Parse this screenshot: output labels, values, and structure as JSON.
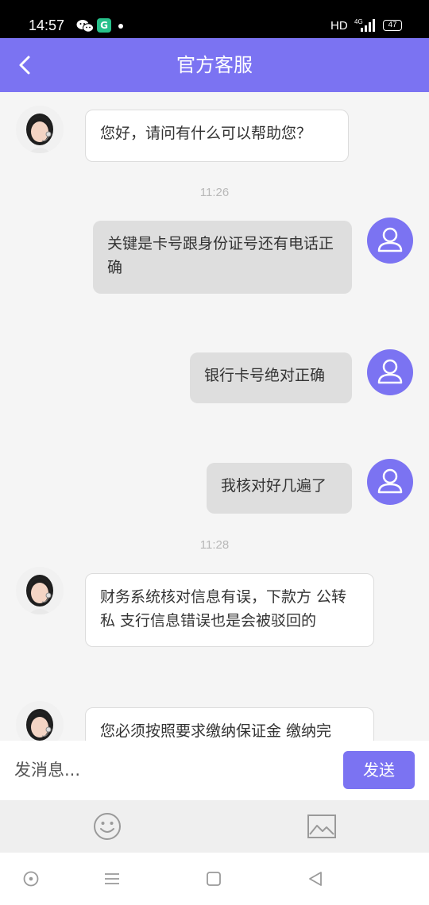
{
  "status_bar": {
    "time": "14:57",
    "hd": "HD",
    "network": "4G",
    "battery": "47"
  },
  "header": {
    "title": "官方客服"
  },
  "messages": [
    {
      "side": "left",
      "text": "您好，请问有什么可以帮助您？"
    },
    {
      "timestamp": "11:26"
    },
    {
      "side": "right",
      "text": "关键是卡号跟身份证号还有电话正确"
    },
    {
      "side": "right",
      "text": "银行卡号绝对正确"
    },
    {
      "side": "right",
      "text": "我核对好几遍了"
    },
    {
      "timestamp": "11:28"
    },
    {
      "side": "left",
      "text": "财务系统核对信息有误，下款方 公转私  支行信息错误也是会被驳回的"
    },
    {
      "side": "left",
      "text": "您必须按照要求缴纳保证金 缴纳完"
    }
  ],
  "composer": {
    "placeholder": "发消息...",
    "send_label": "发送"
  },
  "toolbar": {
    "emoji_icon": "smiley-icon",
    "image_icon": "image-icon"
  },
  "colors": {
    "accent": "#7b73f2",
    "status_bar": "#000000",
    "background": "#f5f5f5"
  }
}
